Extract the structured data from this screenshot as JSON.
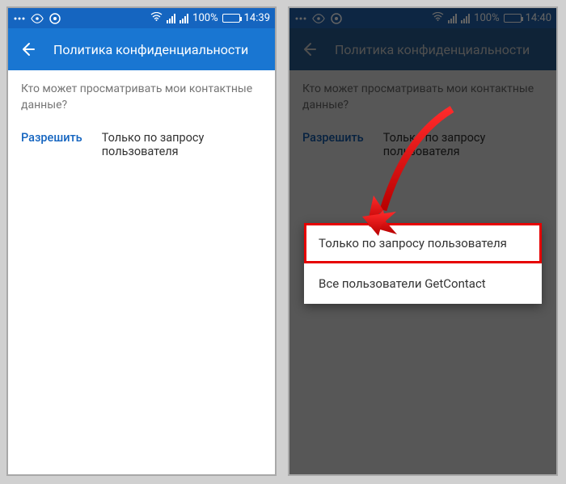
{
  "left": {
    "status": {
      "battery_pct": "100%",
      "time": "14:39"
    },
    "header": {
      "title": "Политика конфиденциальности"
    },
    "section_title": "Кто может просматривать мои контактные данные?",
    "setting": {
      "label": "Разрешить",
      "value": "Только по запросу пользователя"
    }
  },
  "right": {
    "status": {
      "battery_pct": "100%",
      "time": "14:40"
    },
    "header": {
      "title": "Политика конфиденциальности"
    },
    "section_title": "Кто может просматривать мои контактные данные?",
    "setting": {
      "label": "Разрешить",
      "value": "Только по запросу пользователя"
    },
    "popup": {
      "option1": "Только по запросу пользователя",
      "option2": "Все пользователи GetContact"
    }
  }
}
